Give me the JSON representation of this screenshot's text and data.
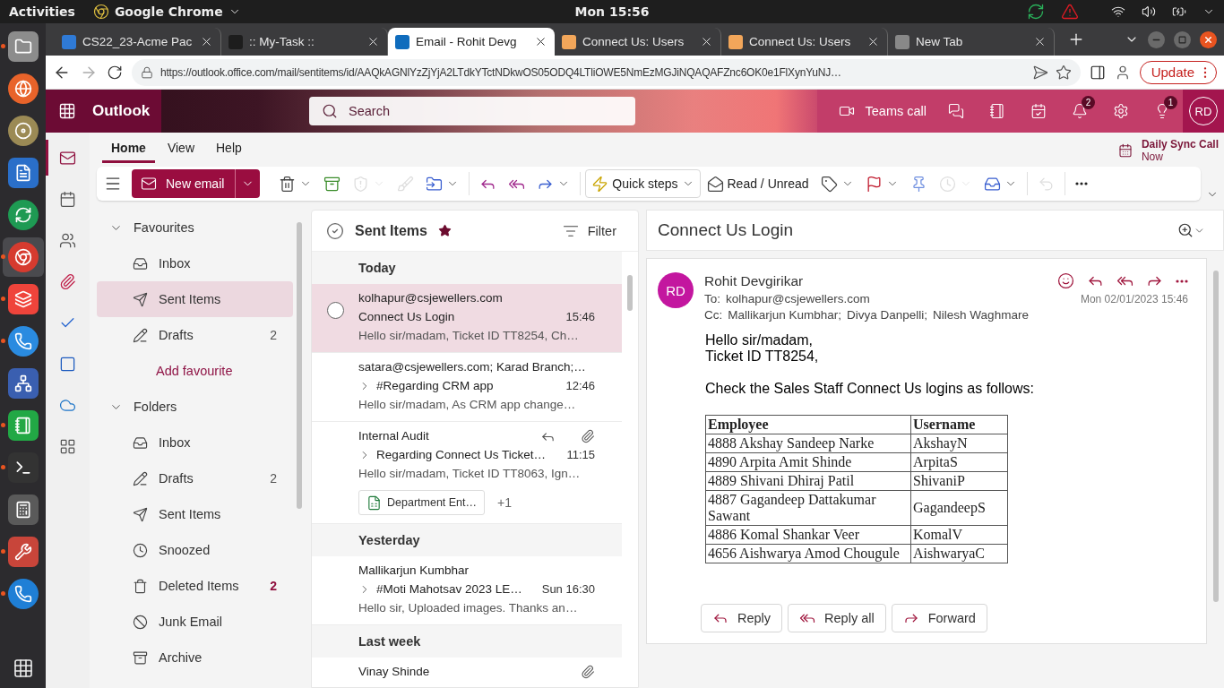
{
  "system_bar": {
    "activities": "Activities",
    "app_menu": "Google Chrome",
    "clock": "Mon 15:56"
  },
  "dock": [
    {
      "running": true,
      "selected": false
    },
    {
      "running": false,
      "selected": false
    },
    {
      "running": false,
      "selected": false
    },
    {
      "running": false,
      "selected": false
    },
    {
      "running": false,
      "selected": false
    },
    {
      "running": true,
      "selected": true
    },
    {
      "running": true,
      "selected": false
    },
    {
      "running": true,
      "selected": false
    },
    {
      "running": false,
      "selected": false
    },
    {
      "running": true,
      "selected": false
    },
    {
      "running": true,
      "selected": false
    },
    {
      "running": false,
      "selected": false
    },
    {
      "running": true,
      "selected": false
    },
    {
      "running": true,
      "selected": false
    }
  ],
  "browser": {
    "tabs": [
      {
        "title": "CS22_23-Acme Pac",
        "selected": false
      },
      {
        "title": ":: My-Task ::",
        "selected": false
      },
      {
        "title": "Email - Rohit Devg",
        "selected": true
      },
      {
        "title": "Connect Us: Users",
        "selected": false
      },
      {
        "title": "Connect Us: Users",
        "selected": false
      },
      {
        "title": "New Tab",
        "selected": false
      }
    ],
    "url": "https://outlook.office.com/mail/sentitems/id/AAQkAGNlYzZjYjA2LTdkYTctNDkwOS05ODQ4LTliOWE5NmEzMGJiNQAQAFZnc6OK0e1FlXynYuNJ…",
    "update_button": "Update"
  },
  "outlook": {
    "app_name": "Outlook",
    "search": {
      "placeholder": "Search"
    },
    "teams_call": "Teams call",
    "notifications_badge": "2",
    "tips_badge": "1",
    "avatar": "RD"
  },
  "rail": [
    {
      "selected": true
    },
    {
      "selected": false
    },
    {
      "selected": false
    },
    {
      "selected": false
    },
    {
      "selected": false
    },
    {
      "selected": false
    },
    {
      "selected": false
    },
    {
      "selected": false
    }
  ],
  "ribbon": {
    "tabs": [
      {
        "label": "Home",
        "selected": true
      },
      {
        "label": "View",
        "selected": false
      },
      {
        "label": "Help",
        "selected": false
      }
    ],
    "new_email": "New email",
    "actions": [
      {
        "kind": "delete",
        "disabled": false,
        "has_menu": true
      },
      {
        "kind": "archive",
        "disabled": false,
        "has_menu": false
      },
      {
        "kind": "report",
        "disabled": true,
        "has_menu": true
      },
      {
        "kind": "sweep",
        "disabled": true,
        "has_menu": false
      },
      {
        "kind": "move",
        "disabled": false,
        "has_menu": true
      },
      {
        "kind": "separator"
      },
      {
        "kind": "reply",
        "disabled": false,
        "has_menu": false
      },
      {
        "kind": "reply_all",
        "disabled": false,
        "has_menu": false
      },
      {
        "kind": "forward",
        "disabled": false,
        "has_menu": true
      },
      {
        "kind": "separator"
      },
      {
        "kind": "quick_steps",
        "label": "Quick steps",
        "disabled": false,
        "has_menu": true
      },
      {
        "kind": "read_unread",
        "label": "Read / Unread",
        "disabled": false,
        "has_menu": false
      },
      {
        "kind": "tag",
        "disabled": false,
        "has_menu": true
      },
      {
        "kind": "flag",
        "disabled": false,
        "has_menu": true
      },
      {
        "kind": "pin",
        "disabled": false,
        "has_menu": false
      },
      {
        "kind": "snooze",
        "disabled": true,
        "has_menu": true
      },
      {
        "kind": "rules",
        "disabled": false,
        "has_menu": true
      },
      {
        "kind": "separator"
      },
      {
        "kind": "undo",
        "disabled": true,
        "has_menu": false
      },
      {
        "kind": "separator"
      },
      {
        "kind": "more",
        "disabled": false,
        "has_menu": false
      }
    ],
    "reminder": {
      "title": "Daily Sync Call",
      "time": "Now"
    }
  },
  "folder_pane": {
    "sections": [
      {
        "title": "Favourites",
        "expanded": true,
        "items": [
          {
            "kind": "inbox",
            "label": "Inbox",
            "selected": false
          },
          {
            "kind": "sent",
            "label": "Sent Items",
            "selected": true
          },
          {
            "kind": "drafts",
            "label": "Drafts",
            "count": "2",
            "unread": false,
            "selected": false
          }
        ],
        "add_link": "Add favourite"
      },
      {
        "title": "Folders",
        "expanded": true,
        "items": [
          {
            "kind": "inbox",
            "label": "Inbox",
            "selected": false
          },
          {
            "kind": "drafts",
            "label": "Drafts",
            "count": "2",
            "unread": false,
            "selected": false
          },
          {
            "kind": "sent",
            "label": "Sent Items",
            "selected": false
          },
          {
            "kind": "snoozed",
            "label": "Snoozed",
            "selected": false
          },
          {
            "kind": "deleted",
            "label": "Deleted Items",
            "count": "2",
            "unread": true,
            "selected": false
          },
          {
            "kind": "junk",
            "label": "Junk Email",
            "selected": false
          },
          {
            "kind": "archive",
            "label": "Archive",
            "selected": false
          }
        ]
      }
    ]
  },
  "message_list": {
    "title": "Sent Items",
    "starred": true,
    "filter": "Filter",
    "groups": [
      {
        "label": "Today",
        "messages": [
          {
            "sender": "kolhapur@csjewellers.com",
            "subject": "Connect Us Login",
            "time": "15:46",
            "preview": "Hello sir/madam, Ticket ID TT8254, Ch…",
            "selected": true,
            "thread": false,
            "replied": false,
            "attachment": false
          },
          {
            "sender": "satara@csjewellers.com; Karad Branch;…",
            "subject": "#Regarding CRM app",
            "time": "12:46",
            "preview": "Hello sir/madam, As CRM app change…",
            "selected": false,
            "thread": true,
            "replied": false,
            "attachment": false
          },
          {
            "sender": "Internal Audit",
            "subject": "Regarding Connect Us Ticket…",
            "time": "11:15",
            "preview": "Hello sir/madam, Ticket ID TT8063, Ign…",
            "selected": false,
            "thread": true,
            "replied": true,
            "attachment": true,
            "files": [
              "Department Ent…"
            ],
            "more_files": "+1"
          }
        ]
      },
      {
        "label": "Yesterday",
        "messages": [
          {
            "sender": "Mallikarjun Kumbhar",
            "subject": "#Moti Mahotsav 2023 LE…",
            "time": "Sun 16:30",
            "preview": "Hello sir, Uploaded images. Thanks an…",
            "selected": false,
            "thread": true,
            "replied": false,
            "attachment": false
          }
        ]
      },
      {
        "label": "Last week",
        "messages": [
          {
            "sender": "Vinay Shinde",
            "selected": false,
            "attachment": true
          }
        ]
      }
    ]
  },
  "reading_pane": {
    "subject": "Connect Us Login",
    "message": {
      "avatar": "RD",
      "sender": "Rohit Devgirikar",
      "to_label": "To:",
      "to": "kolhapur@csjewellers.com",
      "cc_label": "Cc:",
      "cc": [
        "Mallikarjun Kumbhar;",
        "Divya Danpelli;",
        "Nilesh Waghmare"
      ],
      "date": "Mon 02/01/2023 15:46",
      "body": [
        [
          "Hello sir/madam,",
          "Ticket ID TT8254,"
        ],
        [
          "Check the Sales Staff Connect Us logins as follows:"
        ]
      ],
      "table": {
        "columns": [
          "Employee",
          "Username"
        ],
        "rows": [
          [
            "4888 Akshay Sandeep Narke",
            "AkshayN"
          ],
          [
            "4890 Arpita Amit Shinde",
            "ArpitaS"
          ],
          [
            "4889 Shivani Dhiraj Patil",
            "ShivaniP"
          ],
          [
            "4887 Gagandeep Dattakumar Sawant",
            "GagandeepS"
          ],
          [
            "4886 Komal Shankar Veer",
            "KomalV"
          ],
          [
            "4656 Aishwarya Amod Chougule",
            "AishwaryaC"
          ]
        ]
      },
      "buttons": [
        {
          "kind": "reply",
          "label": "Reply"
        },
        {
          "kind": "reply_all",
          "label": "Reply all"
        },
        {
          "kind": "forward",
          "label": "Forward"
        }
      ]
    }
  }
}
